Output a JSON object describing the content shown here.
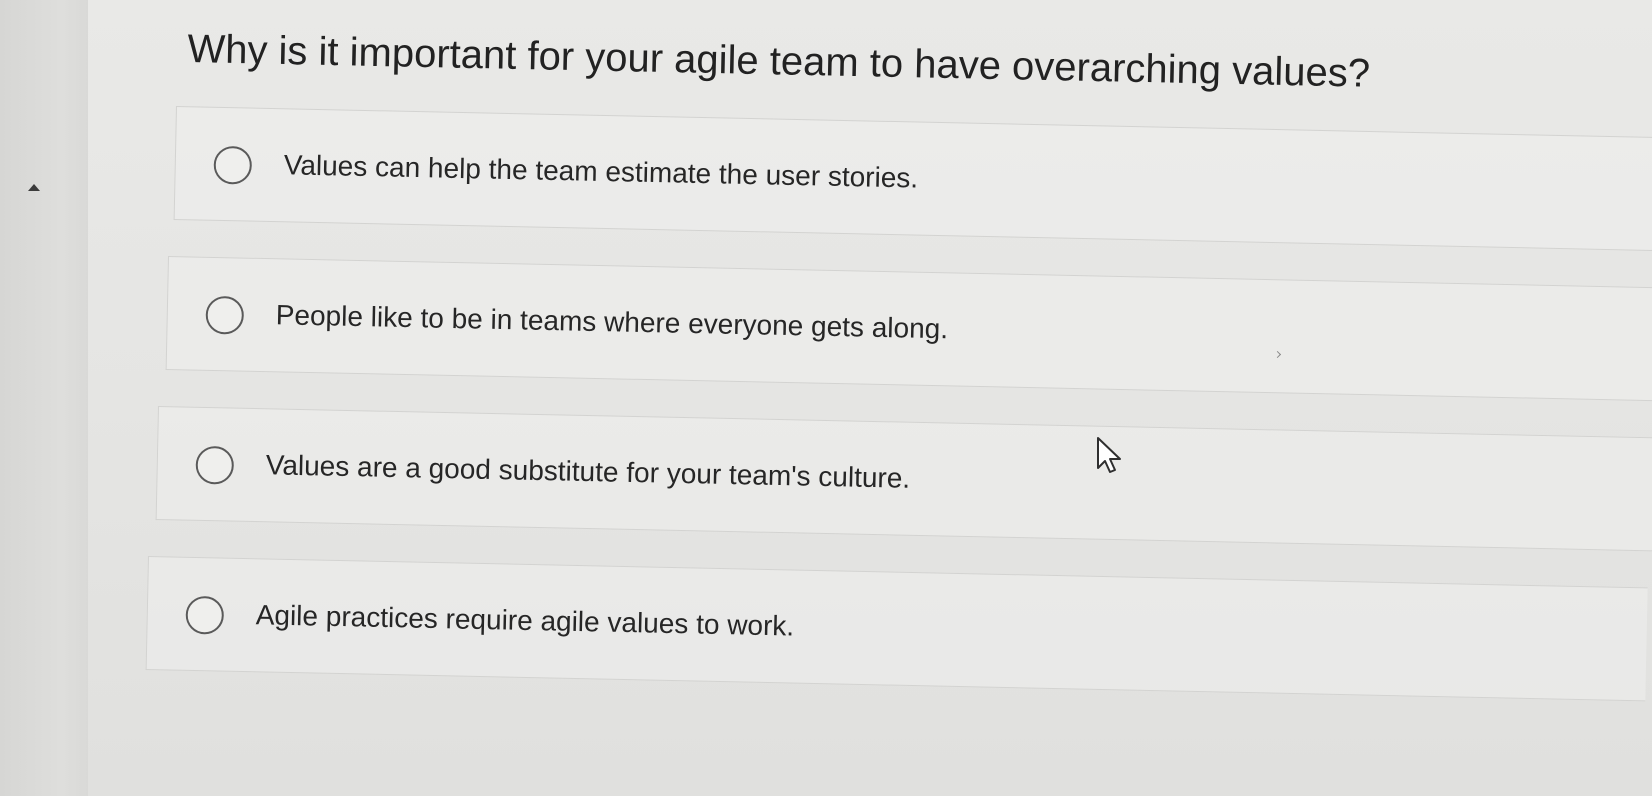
{
  "question": {
    "text": "Why is it important for your agile team to have overarching values?"
  },
  "options": [
    {
      "label": "Values can help the team estimate the user stories.",
      "selected": false
    },
    {
      "label": "People like to be in teams where everyone gets along.",
      "selected": false
    },
    {
      "label": "Values are a good substitute for your team's culture.",
      "selected": false
    },
    {
      "label": "Agile practices require agile values to work.",
      "selected": false
    }
  ],
  "icons": {
    "sidebar_toggle": "caret-up-icon",
    "pointer": "mouse-pointer-icon"
  },
  "colors": {
    "background": "#e4e4e2",
    "text": "#222222",
    "radio_border": "#5a5a5a"
  }
}
